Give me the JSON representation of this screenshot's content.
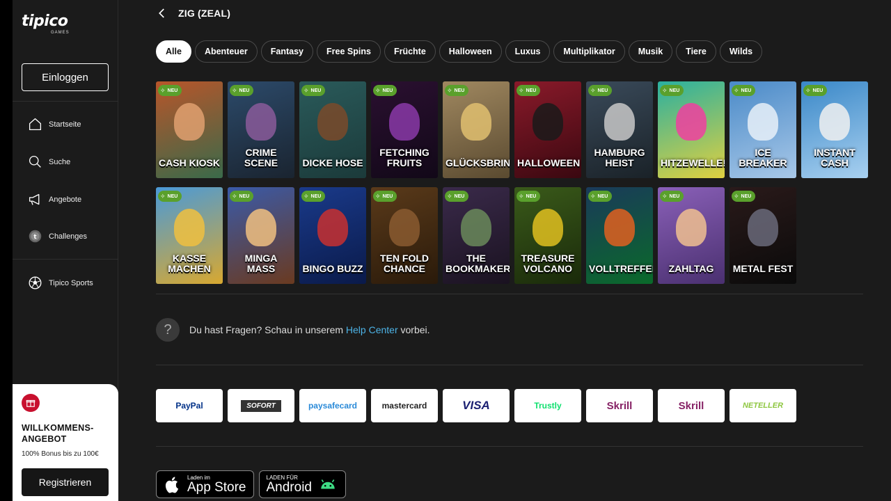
{
  "brand": {
    "name": "tipico",
    "sub": "GAMES"
  },
  "sidebar": {
    "login_label": "Einloggen",
    "items": [
      {
        "label": "Startseite",
        "icon": "home-icon"
      },
      {
        "label": "Suche",
        "icon": "search-icon"
      },
      {
        "label": "Angebote",
        "icon": "megaphone-icon"
      },
      {
        "label": "Challenges",
        "icon": "challenge-icon"
      },
      {
        "label": "Tipico Sports",
        "icon": "soccer-ball-icon"
      }
    ],
    "promo": {
      "title": "WILLKOMMENS-ANGEBOT",
      "subtitle": "100% Bonus bis zu 100€",
      "register_label": "Registrieren"
    }
  },
  "header": {
    "title": "ZIG (ZEAL)"
  },
  "filters": [
    "Alle",
    "Abenteuer",
    "Fantasy",
    "Free Spins",
    "Früchte",
    "Halloween",
    "Luxus",
    "Multiplikator",
    "Musik",
    "Tiere",
    "Wilds"
  ],
  "active_filter": "Alle",
  "badge_label": "NEU",
  "games": [
    {
      "title": "CASH KIOSK",
      "bg": "#b8552a",
      "bg2": "#3a6a4a",
      "art": "#e0a070"
    },
    {
      "title": "CRIME SCENE",
      "bg": "#2c4a6a",
      "bg2": "#1a2430",
      "art": "#8a5a9a"
    },
    {
      "title": "DICKE HOSE",
      "bg": "#2a5a5a",
      "bg2": "#1b3a3a",
      "art": "#7a4a2a"
    },
    {
      "title": "FETCHING FRUITS",
      "bg": "#2a1030",
      "bg2": "#120818",
      "art": "#8a3aa8"
    },
    {
      "title": "GLÜCKSBRINGER",
      "bg": "#a08860",
      "bg2": "#5a4a30",
      "art": "#e0c070"
    },
    {
      "title": "HALLOWEEN",
      "bg": "#8a1a2a",
      "bg2": "#3a0810",
      "art": "#1a1a1a"
    },
    {
      "title": "HAMBURG HEIST",
      "bg": "#3a4a5a",
      "bg2": "#1a2228",
      "art": "#c8c8c8"
    },
    {
      "title": "Hitzewelle!",
      "bg": "#2ab0a0",
      "bg2": "#e0d040",
      "art": "#f040a0"
    },
    {
      "title": "ice breaker",
      "bg": "#4a8ac8",
      "bg2": "#a8c8e8",
      "art": "#e8f0f8"
    },
    {
      "title": "INSTANT CASH",
      "bg": "#3a88c8",
      "bg2": "#a8d0f0",
      "art": "#f0f0f0"
    },
    {
      "title": "KASSE MACHEN",
      "bg": "#4a9ad8",
      "bg2": "#d8a830",
      "art": "#f0c040"
    },
    {
      "title": "Minga Maß",
      "bg": "#3a5aa8",
      "bg2": "#6a3a20",
      "art": "#f0c080"
    },
    {
      "title": "BINGO BUZZ",
      "bg": "#1a3a8a",
      "bg2": "#0a1a4a",
      "art": "#c83030"
    },
    {
      "title": "TEN FOLD CHANCE",
      "bg": "#5a3a1a",
      "bg2": "#2a1a0a",
      "art": "#8a5a30"
    },
    {
      "title": "THE BOOKMAKER",
      "bg": "#3a2a4a",
      "bg2": "#1a1220",
      "art": "#6a8a5a"
    },
    {
      "title": "TREASURE VOLCANO",
      "bg": "#3a5a1a",
      "bg2": "#1a2a0a",
      "art": "#e0c020"
    },
    {
      "title": "VOLLTREFFER",
      "bg": "#1a3a5a",
      "bg2": "#0a6a2a",
      "art": "#e06020"
    },
    {
      "title": "ZAHLTAG",
      "bg": "#8a60b8",
      "bg2": "#4a3070",
      "art": "#f0c090"
    },
    {
      "title": "METAL FEST",
      "bg": "#2a1a1a",
      "bg2": "#0a0a0a",
      "art": "#6a6a7a"
    }
  ],
  "help": {
    "text": "Du hast Fragen? Schau in unserem ",
    "link": "Help Center",
    "suffix": " vorbei."
  },
  "payments": [
    {
      "label": "PayPal",
      "color": "#003087"
    },
    {
      "label": "SOFORT",
      "color": "#333333"
    },
    {
      "label": "paysafecard",
      "color": "#2a8ad8"
    },
    {
      "label": "mastercard",
      "color": "#222222"
    },
    {
      "label": "VISA",
      "color": "#1a1f71"
    },
    {
      "label": "Trustly",
      "color": "#0ee06e"
    },
    {
      "label": "Skrill",
      "color": "#862165"
    },
    {
      "label": "Skrill",
      "color": "#862165"
    },
    {
      "label": "NETELLER",
      "color": "#8dc63f"
    }
  ],
  "stores": [
    {
      "small": "Laden im",
      "big": "App Store"
    },
    {
      "small": "LADEN FÜR",
      "big": "Android"
    }
  ]
}
